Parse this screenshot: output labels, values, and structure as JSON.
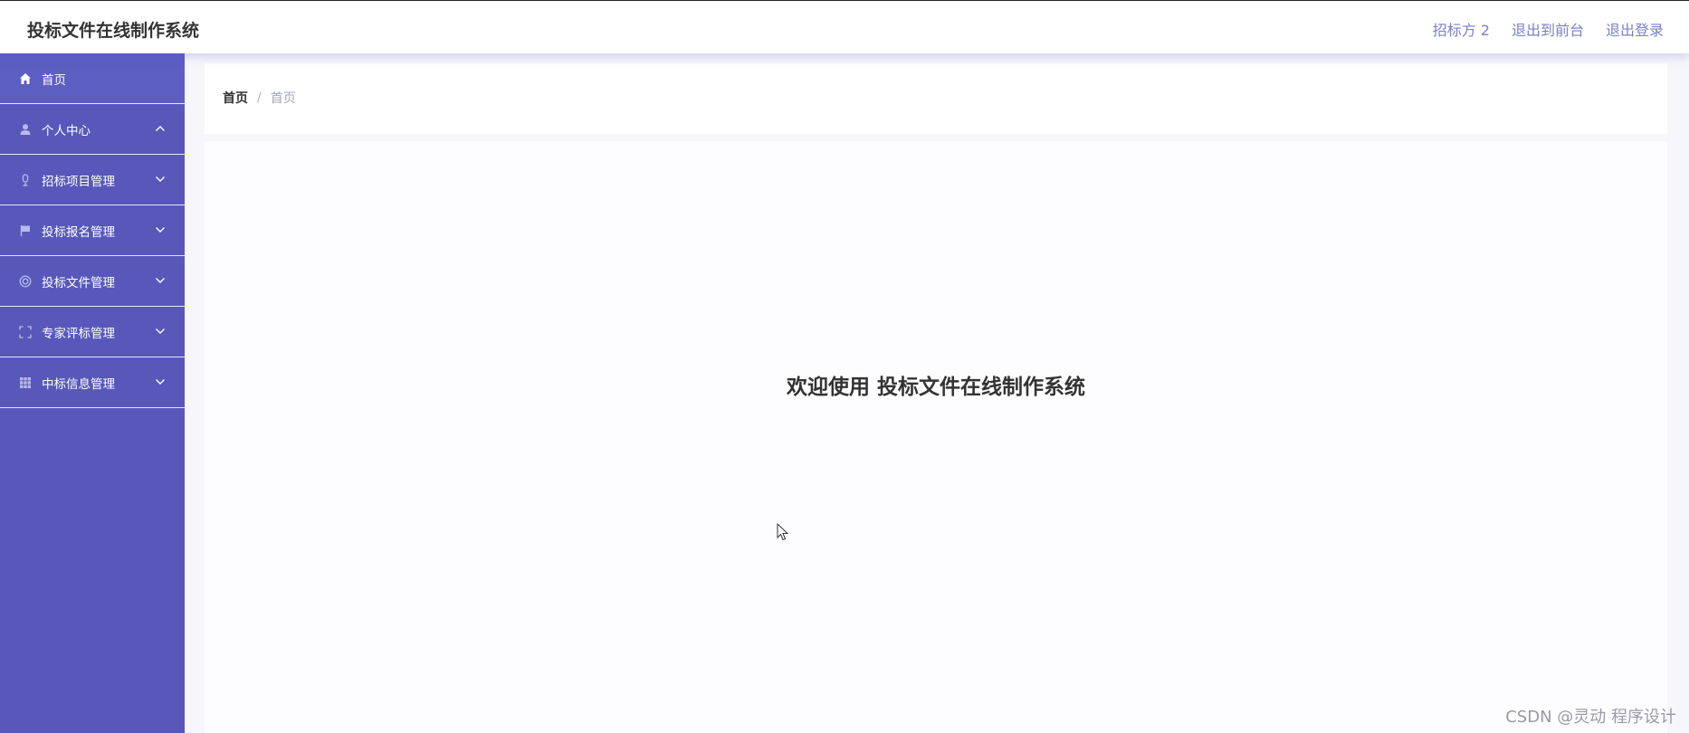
{
  "header": {
    "title": "投标文件在线制作系统",
    "links": [
      "招标方 2",
      "退出到前台",
      "退出登录"
    ]
  },
  "sidebar": {
    "items": [
      {
        "label": "首页",
        "icon": "home-icon"
      },
      {
        "label": "个人中心",
        "icon": "user-icon"
      },
      {
        "label": "招标项目管理",
        "icon": "mic-icon"
      },
      {
        "label": "投标报名管理",
        "icon": "flag-icon"
      },
      {
        "label": "投标文件管理",
        "icon": "help-circle-icon"
      },
      {
        "label": "专家评标管理",
        "icon": "fullscreen-icon"
      },
      {
        "label": "中标信息管理",
        "icon": "grid-icon"
      }
    ]
  },
  "breadcrumb": {
    "home": "首页",
    "separator": "/",
    "current": "首页"
  },
  "main": {
    "welcome": "欢迎使用 投标文件在线制作系统"
  },
  "watermark": "CSDN @灵动 程序设计",
  "colors": {
    "sidebar_bg": "#5758ba",
    "link": "#7b7fc9"
  }
}
